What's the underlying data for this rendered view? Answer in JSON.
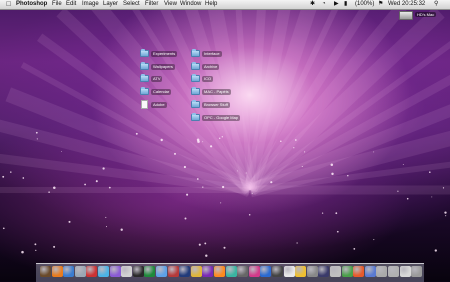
{
  "menubar": {
    "apple_icon": "apple-logo-icon",
    "app_name": "Photoshop",
    "menus": [
      "File",
      "Edit",
      "Image",
      "Layer",
      "Select",
      "Filter",
      "View",
      "Window",
      "Help"
    ],
    "battery": "(100%)",
    "clock": "Wed 20:25:32"
  },
  "desktop": {
    "hard_drive_label": "HD's Mac",
    "col1": [
      "Experiments",
      "Wallpapers",
      "ATV",
      "Calendar",
      "Adobe"
    ],
    "col2": [
      "Interface",
      "Archive",
      "ICO",
      "MAC - Papéis",
      "Browser Stuff",
      "OPC - Google Map"
    ]
  },
  "dock": {
    "colors": [
      "#6a4a2a",
      "#e87b1e",
      "#3a7cd0",
      "#9aa7b4",
      "#c33",
      "#4bb3e6",
      "#8a5bd6",
      "#d2d2d2",
      "#2a2a2a",
      "#1e8a3a",
      "#5da1e8",
      "#b53a3a",
      "#223b7a",
      "#e0b53a",
      "#7a2ab5",
      "#ff8a1e",
      "#3ab5a1",
      "#666",
      "#d23a8a",
      "#2a6ad2",
      "#444",
      "#e8e8e8",
      "#f0c030",
      "#888",
      "#3a3a6a",
      "#c0c0c0",
      "#4aa04a",
      "#e85a2a",
      "#5a7ad2",
      "#aaaaaa",
      "#b0b0b0",
      "#d8d8d8",
      "#9a9a9a"
    ]
  }
}
